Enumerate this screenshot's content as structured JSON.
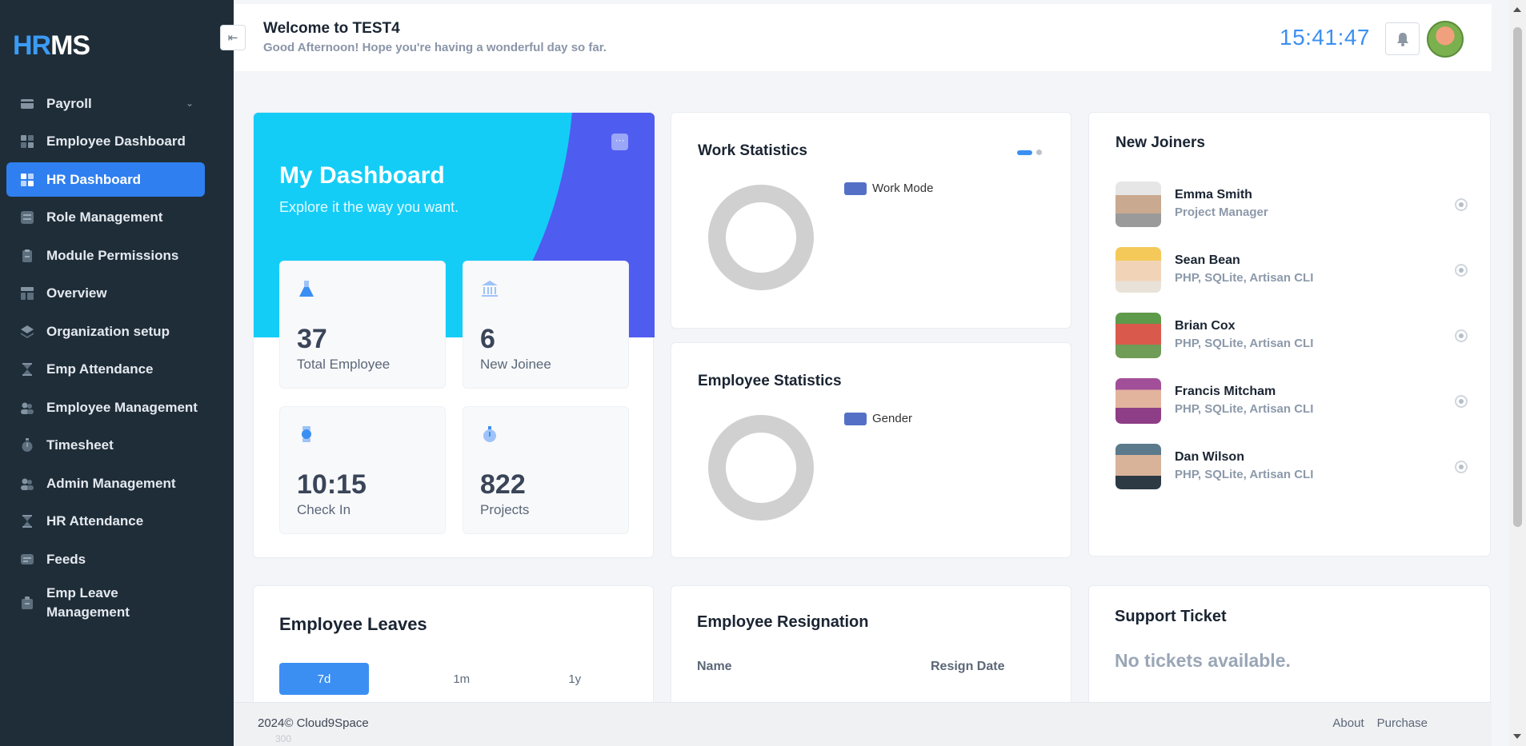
{
  "brand": {
    "part1": "HR",
    "part2": "MS"
  },
  "sidebar": {
    "items": [
      {
        "label": "Payroll",
        "icon": "credit-card-icon"
      },
      {
        "label": "Employee Dashboard",
        "icon": "dashboard-grid-icon"
      },
      {
        "label": "HR Dashboard",
        "icon": "dashboard-grid-icon"
      },
      {
        "label": "Role Management",
        "icon": "list-icon"
      },
      {
        "label": "Module Permissions",
        "icon": "clipboard-icon"
      },
      {
        "label": "Overview",
        "icon": "layout-icon"
      },
      {
        "label": "Organization setup",
        "icon": "layers-icon"
      },
      {
        "label": "Emp Attendance",
        "icon": "hourglass-icon"
      },
      {
        "label": "Employee Management",
        "icon": "users-icon"
      },
      {
        "label": "Timesheet",
        "icon": "stopwatch-icon"
      },
      {
        "label": "Admin Management",
        "icon": "users-icon"
      },
      {
        "label": "HR Attendance",
        "icon": "hourglass-icon"
      },
      {
        "label": "Feeds",
        "icon": "feed-icon"
      },
      {
        "label": "Emp Leave Management",
        "icon": "briefcase-icon"
      }
    ],
    "active": "HR Dashboard"
  },
  "header": {
    "title": "Welcome to TEST4",
    "subtitle": "Good Afternoon! Hope you're having a wonderful day so far.",
    "clock": "15:41:47"
  },
  "dashboard": {
    "title": "My Dashboard",
    "subtitle": "Explore it the way you want.",
    "stats": [
      {
        "value": "37",
        "label": "Total Employee",
        "icon": "flask-icon"
      },
      {
        "value": "6",
        "label": "New Joinee",
        "icon": "bank-icon"
      },
      {
        "value": "10:15",
        "label": "Check In",
        "icon": "watch-icon"
      },
      {
        "value": "822",
        "label": "Projects",
        "icon": "stopwatch-icon"
      }
    ]
  },
  "work_stats": {
    "title": "Work Statistics",
    "legend": "Work Mode"
  },
  "emp_stats": {
    "title": "Employee Statistics",
    "legend": "Gender"
  },
  "joiners": {
    "title": "New Joiners",
    "list": [
      {
        "name": "Emma Smith",
        "role": "Project Manager"
      },
      {
        "name": "Sean Bean",
        "role": "PHP, SQLite, Artisan CLI"
      },
      {
        "name": "Brian Cox",
        "role": "PHP, SQLite, Artisan CLI"
      },
      {
        "name": "Francis Mitcham",
        "role": "PHP, SQLite, Artisan CLI"
      },
      {
        "name": "Dan Wilson",
        "role": "PHP, SQLite, Artisan CLI"
      }
    ]
  },
  "leaves": {
    "title": "Employee Leaves",
    "tabs": [
      "7d",
      "1m",
      "1y"
    ],
    "active_tab": "7d"
  },
  "resignation": {
    "title": "Employee Resignation",
    "columns": [
      "Name",
      "Resign Date"
    ]
  },
  "ticket": {
    "title": "Support Ticket",
    "empty": "No tickets available."
  },
  "footer": {
    "copyright": "2024© Cloud9Space",
    "ghost_value": "300",
    "links": [
      "About",
      "Purchase"
    ]
  },
  "colors": {
    "accent": "#3b8ff2",
    "sidebar_bg": "#1f2d38",
    "hero_cyan": "#14cdf7",
    "hero_indigo": "#4f5cf0"
  }
}
